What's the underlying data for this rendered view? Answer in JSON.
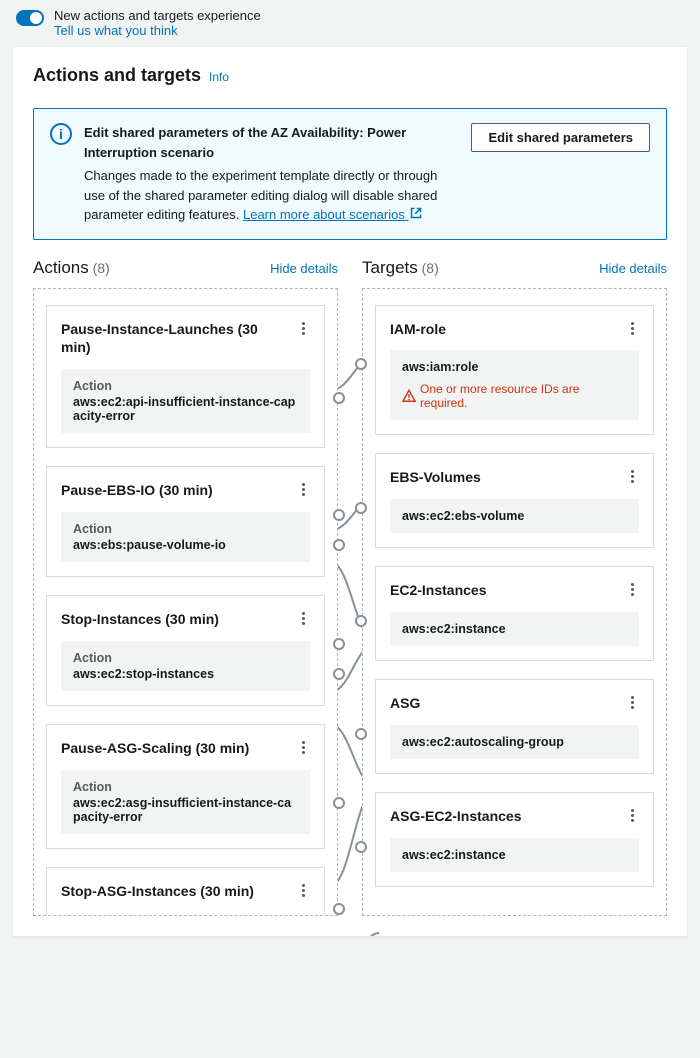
{
  "banner": {
    "title": "New actions and targets experience",
    "link": "Tell us what you think"
  },
  "panel": {
    "title": "Actions and targets",
    "info": "Info"
  },
  "alert": {
    "title": "Edit shared parameters of the AZ Availability: Power Interruption scenario",
    "body": "Changes made to the experiment template directly or through use of the shared parameter editing dialog will disable shared parameter editing features. ",
    "link": "Learn more about scenarios",
    "button": "Edit shared parameters"
  },
  "actions": {
    "label": "Actions",
    "count": "(8)",
    "hide": "Hide details",
    "cards": [
      {
        "title": "Pause-Instance-Launches (30 min)",
        "label": "Action",
        "value": "aws:ec2:api-insufficient-instance-capacity-error"
      },
      {
        "title": "Pause-EBS-IO (30 min)",
        "label": "Action",
        "value": "aws:ebs:pause-volume-io"
      },
      {
        "title": "Stop-Instances (30 min)",
        "label": "Action",
        "value": "aws:ec2:stop-instances"
      },
      {
        "title": "Pause-ASG-Scaling (30 min)",
        "label": "Action",
        "value": "aws:ec2:asg-insufficient-instance-capacity-error"
      },
      {
        "title": "Stop-ASG-Instances (30 min)"
      }
    ]
  },
  "targets": {
    "label": "Targets",
    "count": "(8)",
    "hide": "Hide details",
    "cards": [
      {
        "title": "IAM-role",
        "value": "aws:iam:role",
        "error": "One or more resource IDs are required."
      },
      {
        "title": "EBS-Volumes",
        "value": "aws:ec2:ebs-volume"
      },
      {
        "title": "EC2-Instances",
        "value": "aws:ec2:instance"
      },
      {
        "title": "ASG",
        "value": "aws:ec2:autoscaling-group"
      },
      {
        "title": "ASG-EC2-Instances",
        "value": "aws:ec2:instance"
      }
    ]
  }
}
